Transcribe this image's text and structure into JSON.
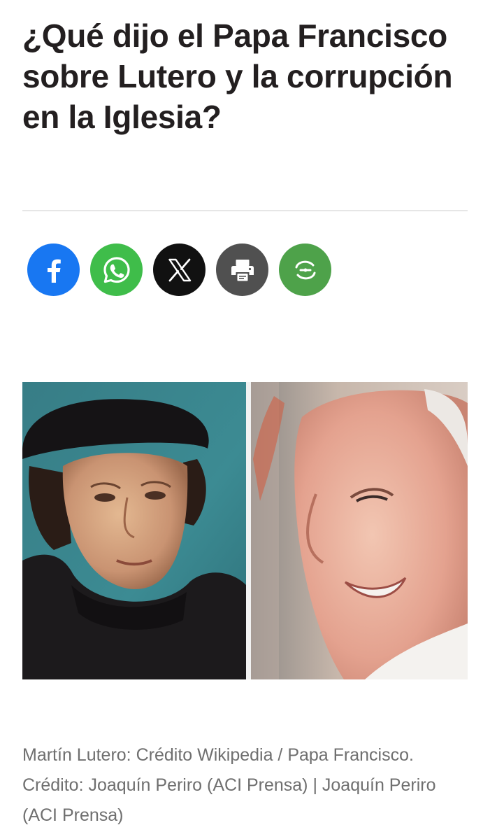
{
  "article": {
    "title": "¿Qué dijo el Papa Francisco sobre Lutero y la corrupción en la Iglesia?",
    "caption": "Martín Lutero: Crédito Wikipedia / Papa Francisco. Crédito: Joaquín Periro (ACI Prensa) | Joaquín Periro (ACI Prensa)"
  },
  "share": {
    "buttons": [
      {
        "icon": "facebook-icon",
        "color": "#1877f2"
      },
      {
        "icon": "whatsapp-icon",
        "color": "#3fbd4a"
      },
      {
        "icon": "x-icon",
        "color": "#111111"
      },
      {
        "icon": "print-icon",
        "color": "#505050"
      },
      {
        "icon": "sharethis-icon",
        "color": "#4ea24a"
      }
    ]
  },
  "image": {
    "left_subject": "Martín Lutero",
    "right_subject": "Papa Francisco"
  }
}
